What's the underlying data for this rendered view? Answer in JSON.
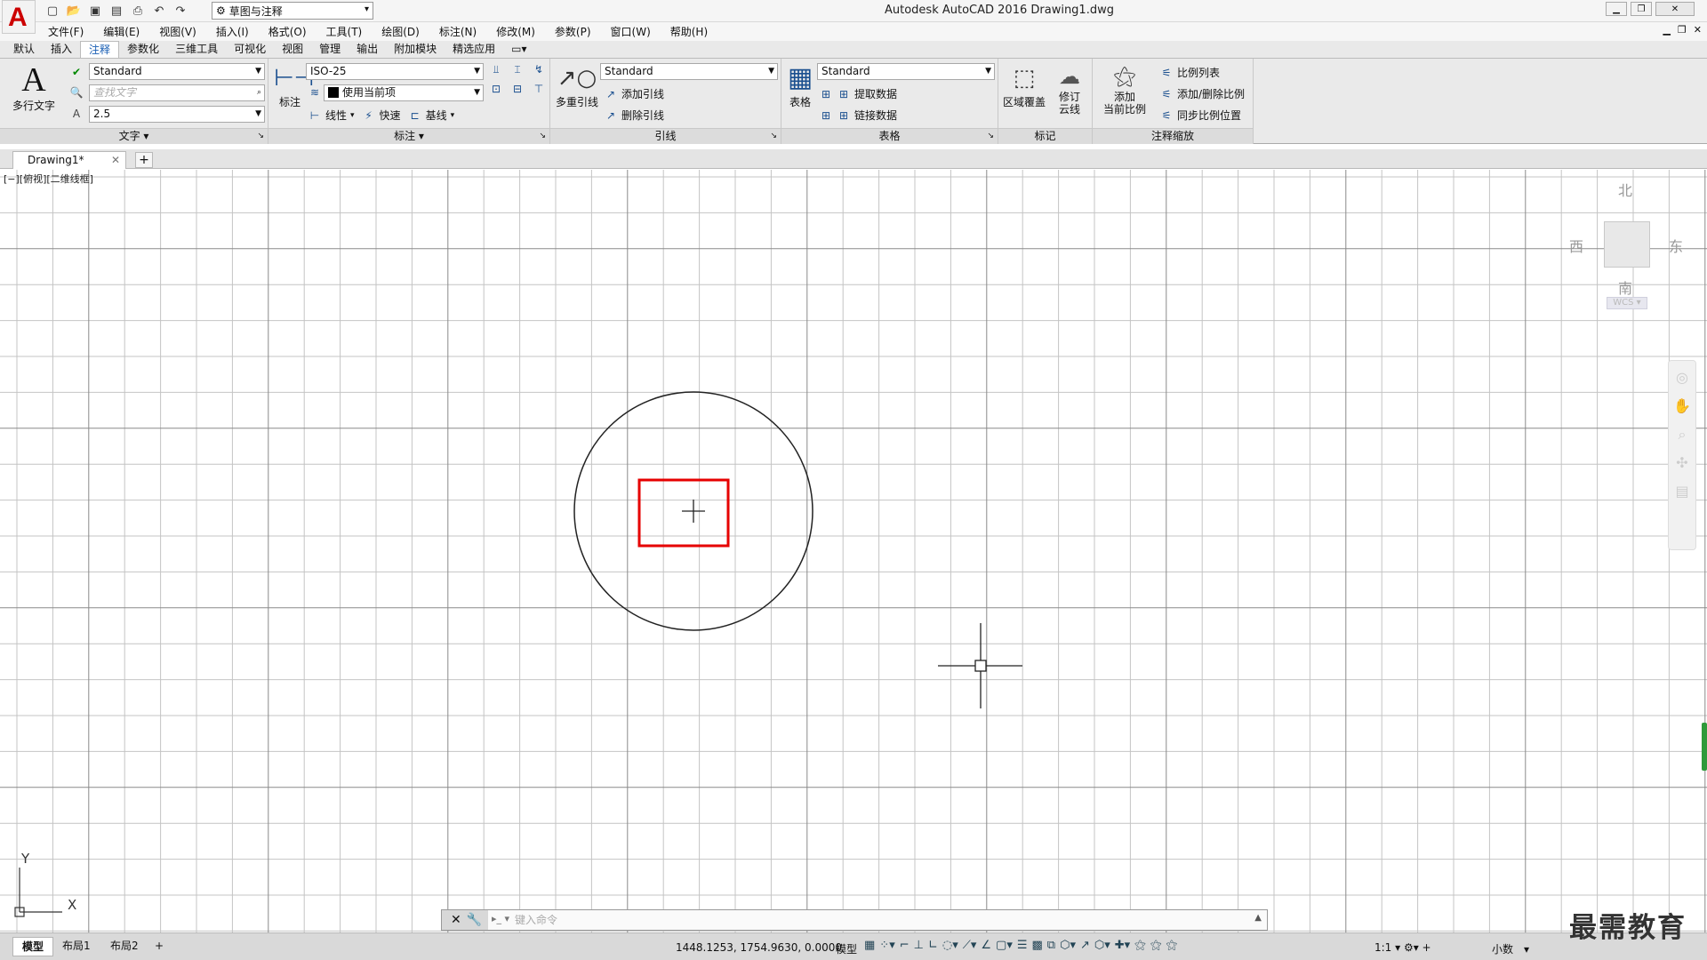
{
  "window": {
    "title": "Autodesk AutoCAD 2016    Drawing1.dwg",
    "workspace": "草图与注释",
    "app_logo": "A"
  },
  "menu": [
    "文件(F)",
    "编辑(E)",
    "视图(V)",
    "插入(I)",
    "格式(O)",
    "工具(T)",
    "绘图(D)",
    "标注(N)",
    "修改(M)",
    "参数(P)",
    "窗口(W)",
    "帮助(H)"
  ],
  "ribbon_tabs": [
    "默认",
    "插入",
    "注释",
    "参数化",
    "三维工具",
    "可视化",
    "视图",
    "管理",
    "输出",
    "附加模块",
    "精选应用"
  ],
  "active_tab": "注释",
  "text_panel": {
    "big_label": "多行文字",
    "style": "Standard",
    "find_placeholder": "查找文字",
    "height": "2.5",
    "footer": "文字"
  },
  "dim_panel": {
    "big_label": "标注",
    "style": "ISO-25",
    "layer": "使用当前项",
    "linear": "线性",
    "quick": "快速",
    "baseline": "基线",
    "footer": "标注"
  },
  "leader_panel": {
    "big_label": "多重引线",
    "style": "Standard",
    "add": "添加引线",
    "remove": "删除引线",
    "footer": "引线"
  },
  "table_panel": {
    "big_label": "表格",
    "style": "Standard",
    "extract": "提取数据",
    "link": "链接数据",
    "footer": "表格"
  },
  "markup_panel": {
    "wipeout": "区域覆盖",
    "revcloud_1": "修订",
    "revcloud_2": "云线",
    "footer": "标记"
  },
  "scale_panel": {
    "add_1": "添加",
    "add_2": "当前比例",
    "scale_list": "比例列表",
    "add_delete": "添加/删除比例",
    "sync": "同步比例位置",
    "footer": "注释缩放"
  },
  "document_tab": "Drawing1*",
  "viewport_label": "[−][俯视][二维线框]",
  "viewcube": {
    "north": "北",
    "south": "南",
    "east": "东",
    "west": "西",
    "wcs": "WCS"
  },
  "ucs": {
    "x": "X",
    "y": "Y"
  },
  "command": {
    "placeholder": "键入命令"
  },
  "layout_tabs": [
    "模型",
    "布局1",
    "布局2"
  ],
  "status": {
    "coords": "1448.1253, 1754.9630, 0.0000",
    "model": "模型",
    "scale": "1:1",
    "units": "小数"
  },
  "watermark": "最需教育",
  "colors": {
    "highlight_box": "#e60000",
    "grid": "#c4c4c4",
    "grid_major": "#8a8a8a",
    "geometry": "#222222"
  }
}
